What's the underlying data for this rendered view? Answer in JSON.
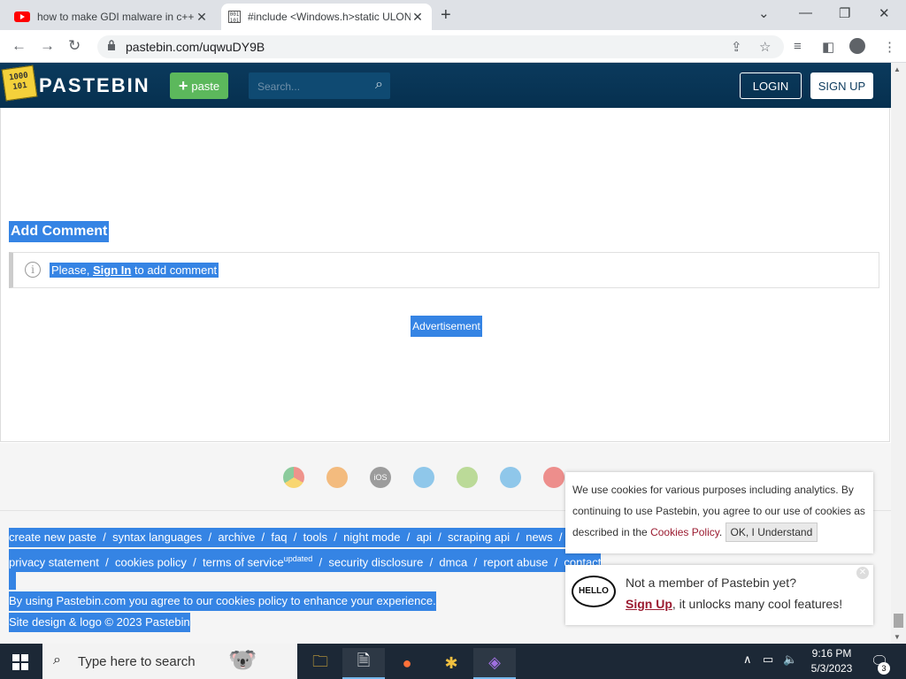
{
  "browser": {
    "tabs": [
      {
        "title": "how to make GDI malware in c++",
        "active": false
      },
      {
        "title": "#include <Windows.h>static ULONGLONG",
        "active": true
      }
    ],
    "url": "pastebin.com/uqwuDY9B"
  },
  "header": {
    "logo_text": "PASTEBIN",
    "logo_icon_text": "1000 101",
    "paste_label": "paste",
    "search_placeholder": "Search...",
    "login_label": "LOGIN",
    "signup_label": "SIGN UP"
  },
  "comment": {
    "title": "Add Comment",
    "prefix": "Please, ",
    "link": "Sign In",
    "suffix": " to add comment"
  },
  "ad_label": "Advertisement",
  "footer": {
    "row1": [
      "create new paste",
      "syntax languages",
      "archive",
      "faq",
      "tools",
      "night mode",
      "api",
      "scraping api",
      "news"
    ],
    "row2": [
      "privacy statement",
      "cookies policy",
      "terms of service",
      "security disclosure",
      "dmca",
      "report abuse",
      "contact"
    ],
    "updated_sup": "updated",
    "separator": "/",
    "cookie_sentence": "By using Pastebin.com you agree to our cookies policy to enhance your experience.",
    "copyright": "Site design & logo © 2023 Pastebin"
  },
  "cookie_popup": {
    "text": "We use cookies for various purposes including analytics. By continuing to use Pastebin, you agree to our use of cookies as described in the ",
    "link": "Cookies Policy",
    "after": ". ",
    "button": "OK, I Understand"
  },
  "member_popup": {
    "hello": "HELLO",
    "line1": "Not a member of Pastebin yet?",
    "link": "Sign Up",
    "line2": ", it unlocks many cool features!"
  },
  "taskbar": {
    "search_placeholder": "Type here to search",
    "time": "9:16 PM",
    "date": "5/3/2023",
    "notification_count": "3"
  }
}
